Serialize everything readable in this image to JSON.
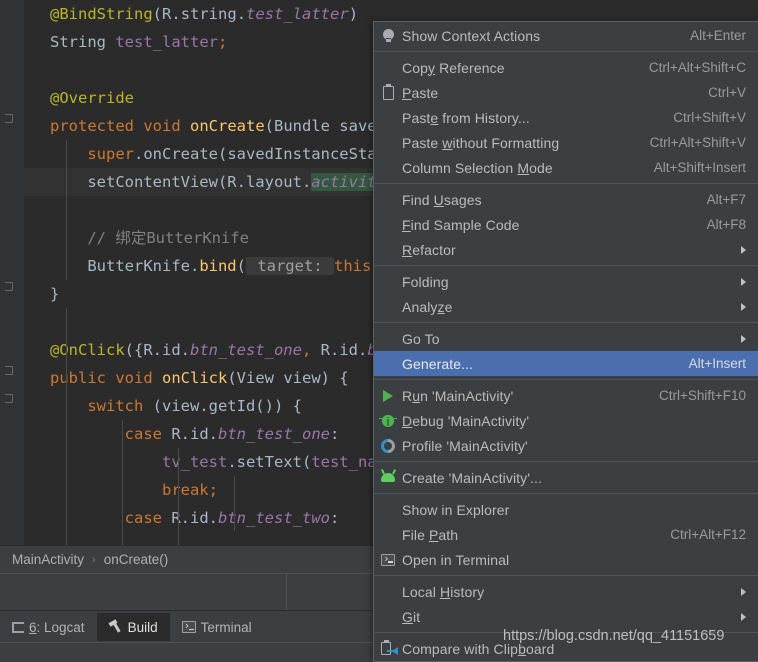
{
  "editor": {
    "lines": [
      {
        "indent": 0,
        "current": false,
        "tokens": [
          {
            "t": "@BindString",
            "c": "anno"
          },
          {
            "t": "(",
            "c": "txt"
          },
          {
            "t": "R",
            "c": "txt"
          },
          {
            "t": ".",
            "c": "txt"
          },
          {
            "t": "string",
            "c": "txt"
          },
          {
            "t": ".",
            "c": "txt"
          },
          {
            "t": "test_latter",
            "c": "fld"
          },
          {
            "t": ")",
            "c": "txt"
          }
        ]
      },
      {
        "indent": 0,
        "current": false,
        "tokens": [
          {
            "t": "String ",
            "c": "txt"
          },
          {
            "t": "test_latter",
            "c": "fldp"
          },
          {
            "t": ";",
            "c": "kw"
          }
        ]
      },
      {
        "indent": 0,
        "current": false,
        "tokens": []
      },
      {
        "indent": 0,
        "current": false,
        "tokens": [
          {
            "t": "@Override",
            "c": "anno"
          }
        ]
      },
      {
        "indent": 0,
        "current": false,
        "tokens": [
          {
            "t": "protected ",
            "c": "kw"
          },
          {
            "t": "void ",
            "c": "kw"
          },
          {
            "t": "onCreate",
            "c": "mth"
          },
          {
            "t": "(Bundle savedInstanceState) {",
            "c": "txt"
          }
        ]
      },
      {
        "indent": 1,
        "current": false,
        "tokens": [
          {
            "t": "super",
            "c": "kw"
          },
          {
            "t": ".onCreate(savedInstanceState);",
            "c": "txt"
          }
        ]
      },
      {
        "indent": 1,
        "current": true,
        "tokens": [
          {
            "t": "setContentView(R.layout.",
            "c": "txt"
          },
          {
            "t": "activity_main",
            "c": "fld searchhl"
          },
          {
            "t": ");",
            "c": "txt"
          }
        ]
      },
      {
        "indent": 1,
        "current": false,
        "tokens": []
      },
      {
        "indent": 1,
        "current": false,
        "tokens": [
          {
            "t": "// 绑定ButterKnife",
            "c": "cmt"
          }
        ]
      },
      {
        "indent": 1,
        "current": false,
        "tokens": [
          {
            "t": "ButterKnife.",
            "c": "txt"
          },
          {
            "t": "bind",
            "c": "mth"
          },
          {
            "t": "(",
            "c": "txt"
          },
          {
            "t": " target: ",
            "c": "hintbox"
          },
          {
            "t": "this",
            "c": "kw"
          },
          {
            "t": ");",
            "c": "txt"
          }
        ]
      },
      {
        "indent": 0,
        "current": false,
        "tokens": [
          {
            "t": "}",
            "c": "txt"
          }
        ]
      },
      {
        "indent": 0,
        "current": false,
        "tokens": []
      },
      {
        "indent": 0,
        "current": false,
        "tokens": [
          {
            "t": "@OnClick",
            "c": "anno"
          },
          {
            "t": "({R.id.",
            "c": "txt"
          },
          {
            "t": "btn_test_one",
            "c": "fld"
          },
          {
            "t": ", ",
            "c": "kw"
          },
          {
            "t": "R.id.",
            "c": "txt"
          },
          {
            "t": "btn_test_two",
            "c": "fld"
          },
          {
            "t": "})",
            "c": "txt"
          }
        ]
      },
      {
        "indent": 0,
        "current": false,
        "tokens": [
          {
            "t": "public ",
            "c": "kw"
          },
          {
            "t": "void ",
            "c": "kw"
          },
          {
            "t": "onClick",
            "c": "mth"
          },
          {
            "t": "(View view) {",
            "c": "txt"
          }
        ]
      },
      {
        "indent": 1,
        "current": false,
        "tokens": [
          {
            "t": "switch ",
            "c": "kw"
          },
          {
            "t": "(view.getId()) {",
            "c": "txt"
          }
        ]
      },
      {
        "indent": 2,
        "current": false,
        "tokens": [
          {
            "t": "case ",
            "c": "kw"
          },
          {
            "t": "R.id.",
            "c": "txt"
          },
          {
            "t": "btn_test_one",
            "c": "fld"
          },
          {
            "t": ":",
            "c": "txt"
          }
        ]
      },
      {
        "indent": 3,
        "current": false,
        "tokens": [
          {
            "t": "tv_test",
            "c": "fldp"
          },
          {
            "t": ".setText(",
            "c": "txt"
          },
          {
            "t": "test_name",
            "c": "fldp"
          },
          {
            "t": ");",
            "c": "txt"
          }
        ]
      },
      {
        "indent": 3,
        "current": false,
        "tokens": [
          {
            "t": "break",
            "c": "kw"
          },
          {
            "t": ";",
            "c": "kw"
          }
        ]
      },
      {
        "indent": 2,
        "current": false,
        "tokens": [
          {
            "t": "case ",
            "c": "kw"
          },
          {
            "t": "R.id.",
            "c": "txt"
          },
          {
            "t": "btn_test_two",
            "c": "fld"
          },
          {
            "t": ":",
            "c": "txt"
          }
        ]
      }
    ]
  },
  "breadcrumb": {
    "items": [
      "MainActivity",
      "onCreate()"
    ],
    "separator": "›"
  },
  "tool_windows": {
    "tabs": [
      {
        "label": "6: Logcat",
        "icon": "logcat-icon",
        "mnemonic": "6",
        "active": false
      },
      {
        "label": "Build",
        "icon": "hammer-icon",
        "mnemonic": "",
        "active": true
      },
      {
        "label": "Terminal",
        "icon": "terminal-icon",
        "mnemonic": "",
        "active": false
      }
    ]
  },
  "context_menu": {
    "selected_index": 12,
    "highlight_color": "#4b6eaf",
    "background_color": "#3c3f41",
    "items": [
      {
        "label": "Show Context Actions",
        "accel": "Alt+Enter",
        "icon": "lightbulb-icon",
        "mnemonic": "",
        "submenu": false,
        "selected": false
      },
      {
        "separator": true
      },
      {
        "label": "Copy Reference",
        "accel": "Ctrl+Alt+Shift+C",
        "icon": "",
        "mnemonic": "y",
        "submenu": false,
        "selected": false
      },
      {
        "label": "Paste",
        "accel": "Ctrl+V",
        "icon": "clipboard-icon",
        "mnemonic": "P",
        "submenu": false,
        "selected": false
      },
      {
        "label": "Paste from History...",
        "accel": "Ctrl+Shift+V",
        "icon": "",
        "mnemonic": "e",
        "submenu": false,
        "selected": false
      },
      {
        "label": "Paste without Formatting",
        "accel": "Ctrl+Alt+Shift+V",
        "icon": "",
        "mnemonic": "w",
        "submenu": false,
        "selected": false
      },
      {
        "label": "Column Selection Mode",
        "accel": "Alt+Shift+Insert",
        "icon": "",
        "mnemonic": "M",
        "submenu": false,
        "selected": false
      },
      {
        "separator": true
      },
      {
        "label": "Find Usages",
        "accel": "Alt+F7",
        "icon": "",
        "mnemonic": "U",
        "submenu": false,
        "selected": false
      },
      {
        "label": "Find Sample Code",
        "accel": "Alt+F8",
        "icon": "",
        "mnemonic": "F",
        "submenu": false,
        "selected": false
      },
      {
        "label": "Refactor",
        "accel": "",
        "icon": "",
        "mnemonic": "R",
        "submenu": true,
        "selected": false
      },
      {
        "separator": true
      },
      {
        "label": "Folding",
        "accel": "",
        "icon": "",
        "mnemonic": "",
        "submenu": true,
        "selected": false
      },
      {
        "label": "Analyze",
        "accel": "",
        "icon": "",
        "mnemonic": "z",
        "submenu": true,
        "selected": false
      },
      {
        "separator": true
      },
      {
        "label": "Go To",
        "accel": "",
        "icon": "",
        "mnemonic": "",
        "submenu": true,
        "selected": false
      },
      {
        "label": "Generate...",
        "accel": "Alt+Insert",
        "icon": "",
        "mnemonic": "",
        "submenu": false,
        "selected": true
      },
      {
        "separator": true
      },
      {
        "label": "Run 'MainActivity'",
        "accel": "Ctrl+Shift+F10",
        "icon": "run-icon",
        "mnemonic": "u",
        "submenu": false,
        "selected": false
      },
      {
        "label": "Debug 'MainActivity'",
        "accel": "",
        "icon": "debug-icon",
        "mnemonic": "D",
        "submenu": false,
        "selected": false
      },
      {
        "label": "Profile 'MainActivity'",
        "accel": "",
        "icon": "profile-icon",
        "mnemonic": "",
        "submenu": false,
        "selected": false
      },
      {
        "separator": true
      },
      {
        "label": "Create 'MainActivity'...",
        "accel": "",
        "icon": "android-icon",
        "mnemonic": "",
        "submenu": false,
        "selected": false
      },
      {
        "separator": true
      },
      {
        "label": "Show in Explorer",
        "accel": "",
        "icon": "",
        "mnemonic": "",
        "submenu": false,
        "selected": false
      },
      {
        "label": "File Path",
        "accel": "Ctrl+Alt+F12",
        "icon": "",
        "mnemonic": "P",
        "submenu": false,
        "selected": false
      },
      {
        "label": "Open in Terminal",
        "accel": "",
        "icon": "terminal-icon",
        "mnemonic": "",
        "submenu": false,
        "selected": false
      },
      {
        "separator": true
      },
      {
        "label": "Local History",
        "accel": "",
        "icon": "",
        "mnemonic": "H",
        "submenu": true,
        "selected": false
      },
      {
        "label": "Git",
        "accel": "",
        "icon": "",
        "mnemonic": "G",
        "submenu": true,
        "selected": false
      },
      {
        "separator": true
      },
      {
        "label": "Compare with Clipboard",
        "accel": "",
        "icon": "compare-clipboard-icon",
        "mnemonic": "b",
        "submenu": false,
        "selected": false
      }
    ]
  },
  "watermark": {
    "text": "https://blog.csdn.net/qq_41151659"
  }
}
